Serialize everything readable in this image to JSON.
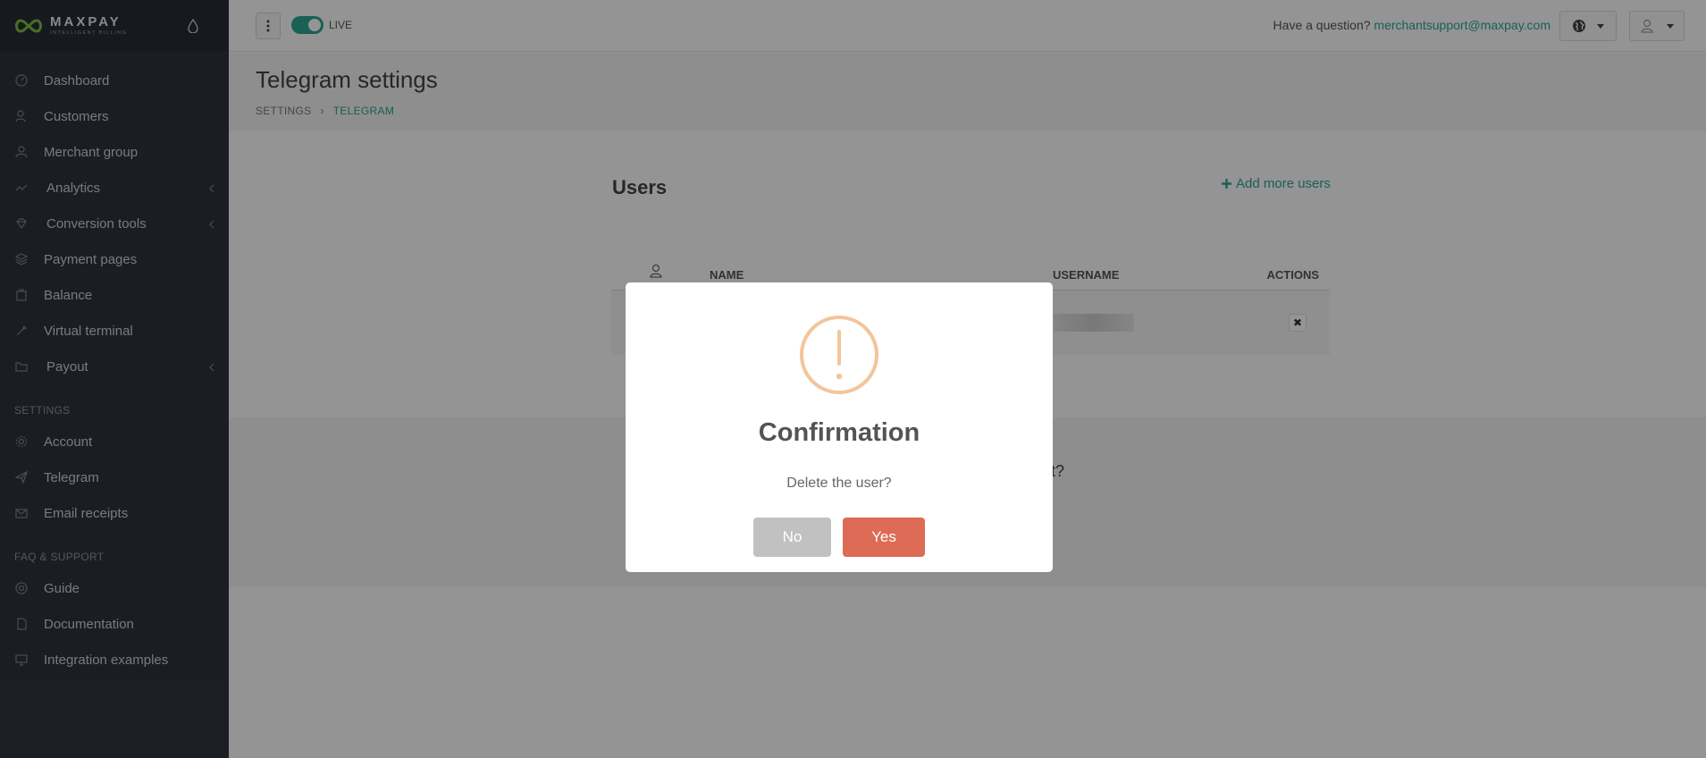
{
  "brand": {
    "name": "MAXPAY",
    "tagline": "INTELLIGENT BILLING"
  },
  "sidebar": {
    "main_items": [
      {
        "label": "Dashboard",
        "icon": "dashboard-icon"
      },
      {
        "label": "Customers",
        "icon": "customers-icon"
      },
      {
        "label": "Merchant group",
        "icon": "merchant-group-icon"
      },
      {
        "label": "Analytics",
        "icon": "analytics-icon",
        "has_submenu": true
      },
      {
        "label": "Conversion tools",
        "icon": "diamond-icon",
        "has_submenu": true
      },
      {
        "label": "Payment pages",
        "icon": "layers-icon"
      },
      {
        "label": "Balance",
        "icon": "balance-icon"
      },
      {
        "label": "Virtual terminal",
        "icon": "terminal-icon"
      },
      {
        "label": "Payout",
        "icon": "folder-icon",
        "has_submenu": true
      }
    ],
    "settings_heading": "SETTINGS",
    "settings_items": [
      {
        "label": "Account",
        "icon": "gear-icon"
      },
      {
        "label": "Telegram",
        "icon": "paper-plane-icon"
      },
      {
        "label": "Email receipts",
        "icon": "mail-icon"
      }
    ],
    "support_heading": "FAQ & SUPPORT",
    "support_items": [
      {
        "label": "Guide",
        "icon": "lifebuoy-icon"
      },
      {
        "label": "Documentation",
        "icon": "document-icon"
      },
      {
        "label": "Integration examples",
        "icon": "monitor-icon"
      }
    ]
  },
  "topbar": {
    "live_label": "LIVE",
    "live_enabled": true,
    "question_text": "Have a question? ",
    "support_email": "merchantsupport@maxpay.com"
  },
  "page": {
    "title": "Telegram settings",
    "breadcrumb": [
      "SETTINGS",
      "TELEGRAM"
    ]
  },
  "users": {
    "title": "Users",
    "add_link": "Add more users",
    "columns": {
      "name": "NAME",
      "username": "USERNAME",
      "actions": "ACTIONS"
    },
    "partial_text": "t?"
  },
  "modal": {
    "title": "Confirmation",
    "message": "Delete the user?",
    "no_label": "No",
    "yes_label": "Yes"
  },
  "colors": {
    "accent": "#2ba593",
    "sidebar_bg": "#2e353d",
    "danger": "#dd6b55",
    "warning": "#f3c59a"
  }
}
